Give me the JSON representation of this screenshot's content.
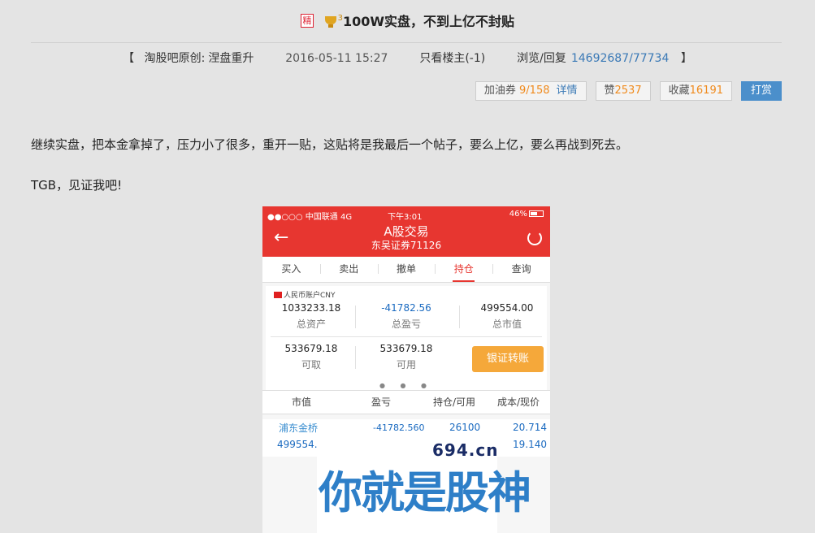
{
  "post": {
    "badge": "精",
    "level": "3",
    "title": "100W实盘，不到上亿不封贴"
  },
  "meta": {
    "open_bracket": "【",
    "author_label": "淘股吧原创:",
    "author": "涅盘重升",
    "date": "2016-05-11 15:27",
    "only_owner": "只看楼主(-1)",
    "views_label": "浏览/回复",
    "views": "14692687",
    "slash": "/",
    "replies": "77734",
    "close_bracket": "】"
  },
  "actions": {
    "fuel_label": "加油券",
    "fuel_value": "9/158",
    "detail": "详情",
    "like_label": "赞",
    "like_value": "2537",
    "fav_label": "收藏",
    "fav_value": "16191",
    "reward": "打赏"
  },
  "content": {
    "p1": "继续实盘，把本金拿掉了，压力小了很多，重开一贴，这贴将是我最后一个帖子，要么上亿，要么再战到死去。",
    "p2": "TGB，见证我吧!"
  },
  "phone": {
    "status_left": "●●○○○ 中国联通  4G",
    "status_time": "下午3:01",
    "status_battery": "46%",
    "header_title": "A股交易",
    "header_subtitle": "东吴证券71126",
    "back": "←",
    "tabs": [
      "买入",
      "卖出",
      "撤单",
      "持仓",
      "查询"
    ],
    "active_tab": 3,
    "account": "人民币账户CNY",
    "total_assets": "1033233.18",
    "total_assets_label": "总资产",
    "total_pnl": "-41782.56",
    "total_pnl_label": "总盈亏",
    "market_value": "499554.00",
    "market_value_label": "总市值",
    "withdrawable": "533679.18",
    "withdrawable_label": "可取",
    "available": "533679.18",
    "available_label": "可用",
    "transfer": "银证转账",
    "dots": "● ● ●",
    "table_headers": [
      "市值",
      "盈亏",
      "持仓/可用",
      "成本/现价"
    ],
    "row": {
      "name": "浦东金桥",
      "value": "499554.0",
      "pnl": "-41782.560",
      "hold": "26100",
      "cost": "20.714",
      "price": "19.140"
    }
  },
  "watermark": {
    "site": "694.cn",
    "text": "你就是股神"
  }
}
